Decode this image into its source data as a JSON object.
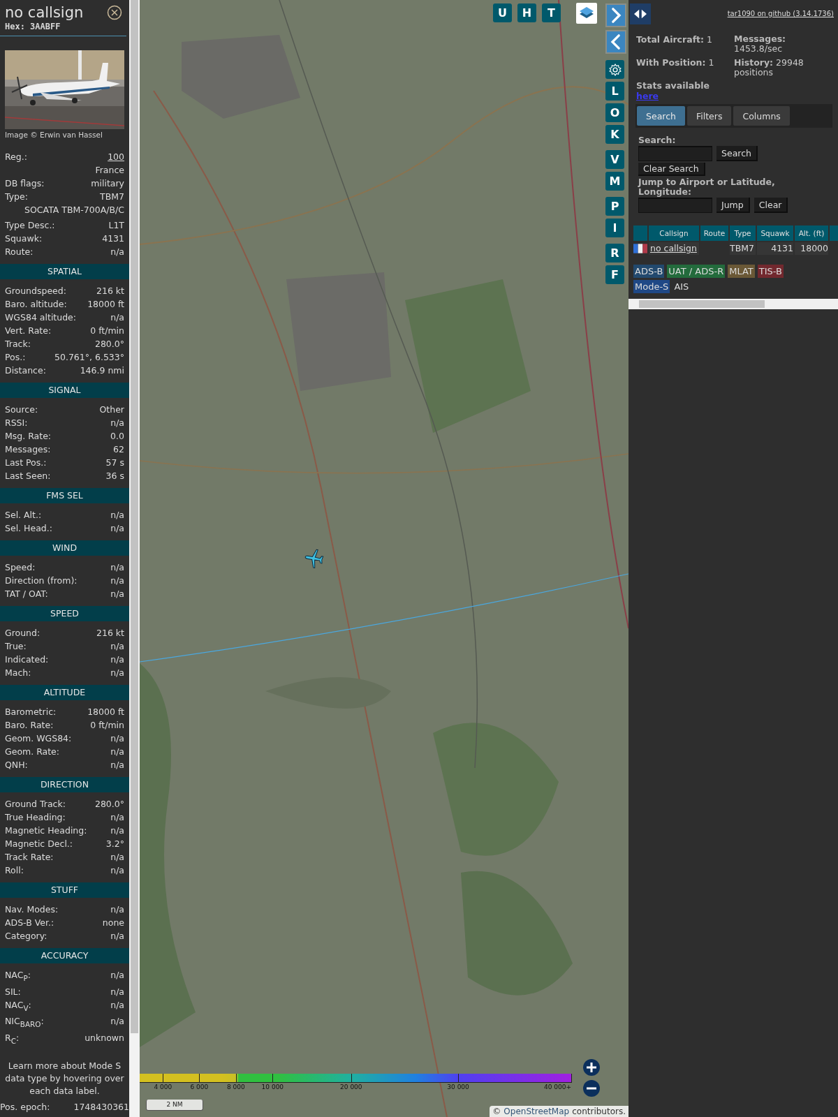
{
  "sidebar": {
    "title": "no callsign",
    "hex": "Hex: 3AABFF",
    "photo_credit": "Image © Erwin van Hassel",
    "info_rows": [
      {
        "kind": "link",
        "label": "Reg.:",
        "value": "100"
      },
      {
        "kind": "value",
        "value": "France"
      },
      {
        "kind": "pair",
        "label": "DB flags:",
        "value": "military"
      },
      {
        "kind": "pair",
        "label": "Type:",
        "value": "TBM7"
      },
      {
        "kind": "value",
        "value": "SOCATA TBM-700A/B/C"
      },
      {
        "kind": "pair",
        "label": "Type Desc.:",
        "value": "L1T"
      },
      {
        "kind": "pair",
        "label": "Squawk:",
        "value": "4131"
      },
      {
        "kind": "pair",
        "label": "Route:",
        "value": "n/a"
      }
    ],
    "sections": [
      {
        "title": "SPATIAL",
        "rows": [
          {
            "label": "Groundspeed:",
            "value": "216 kt"
          },
          {
            "label": "Baro. altitude:",
            "value": "18000 ft"
          },
          {
            "label": "WGS84 altitude:",
            "value": "n/a"
          },
          {
            "label": "Vert. Rate:",
            "value": "0 ft/min"
          },
          {
            "label": "Track:",
            "value": "280.0°"
          },
          {
            "label": "Pos.:",
            "value": "50.761°, 6.533°"
          },
          {
            "label": "Distance:",
            "value": "146.9 nmi"
          }
        ]
      },
      {
        "title": "SIGNAL",
        "rows": [
          {
            "label": "Source:",
            "value": "Other"
          },
          {
            "label": "RSSI:",
            "value": "n/a"
          },
          {
            "label": "Msg. Rate:",
            "value": "0.0"
          },
          {
            "label": "Messages:",
            "value": "62"
          },
          {
            "label": "Last Pos.:",
            "value": "57 s"
          },
          {
            "label": "Last Seen:",
            "value": "36 s"
          }
        ]
      },
      {
        "title": "FMS SEL",
        "rows": [
          {
            "label": "Sel. Alt.:",
            "value": "n/a"
          },
          {
            "label": "Sel. Head.:",
            "value": "n/a"
          }
        ]
      },
      {
        "title": "WIND",
        "rows": [
          {
            "label": "Speed:",
            "value": "n/a"
          },
          {
            "label": "Direction (from):",
            "value": "n/a"
          },
          {
            "label": "TAT / OAT:",
            "value": "n/a"
          }
        ]
      },
      {
        "title": "SPEED",
        "rows": [
          {
            "label": "Ground:",
            "value": "216 kt"
          },
          {
            "label": "True:",
            "value": "n/a"
          },
          {
            "label": "Indicated:",
            "value": "n/a"
          },
          {
            "label": "Mach:",
            "value": "n/a"
          }
        ]
      },
      {
        "title": "ALTITUDE",
        "rows": [
          {
            "label": "Barometric:",
            "value": "18000 ft"
          },
          {
            "label": "Baro. Rate:",
            "value": "0 ft/min"
          },
          {
            "label": "Geom. WGS84:",
            "value": "n/a"
          },
          {
            "label": "Geom. Rate:",
            "value": "n/a"
          },
          {
            "label": "QNH:",
            "value": "n/a"
          }
        ]
      },
      {
        "title": "DIRECTION",
        "rows": [
          {
            "label": "Ground Track:",
            "value": "280.0°"
          },
          {
            "label": "True Heading:",
            "value": "n/a"
          },
          {
            "label": "Magnetic Heading:",
            "value": "n/a"
          },
          {
            "label": "Magnetic Decl.:",
            "value": "3.2°"
          },
          {
            "label": "Track Rate:",
            "value": "n/a"
          },
          {
            "label": "Roll:",
            "value": "n/a"
          }
        ]
      },
      {
        "title": "STUFF",
        "rows": [
          {
            "label": "Nav. Modes:",
            "value": "n/a"
          },
          {
            "label": "ADS-B Ver.:",
            "value": "none"
          },
          {
            "label": "Category:",
            "value": "n/a"
          }
        ]
      },
      {
        "title": "ACCURACY",
        "rows": [
          {
            "label": "NAC$_{P}$:",
            "value": "n/a"
          },
          {
            "label": "SIL:",
            "value": "n/a"
          },
          {
            "label": "NAC$_{V}$:",
            "value": "n/a"
          },
          {
            "label": "NIC$_{BARO}$:",
            "value": "n/a"
          },
          {
            "label": "R$_{C}$:",
            "value": "unknown"
          }
        ]
      }
    ],
    "note": "Learn more about Mode S data type by hovering over each data label.",
    "footer": {
      "label": "Pos. epoch:",
      "value": "1748430361"
    }
  },
  "map": {
    "top_buttons": [
      "U",
      "H",
      "T"
    ],
    "side_groups": [
      [
        {
          "kind": "next"
        },
        {
          "kind": "prev"
        }
      ],
      [
        {
          "kind": "settings"
        },
        {
          "kind": "letter",
          "label": "L"
        },
        {
          "kind": "letter",
          "label": "O"
        },
        {
          "kind": "letter",
          "label": "K"
        }
      ],
      [
        {
          "kind": "letter",
          "label": "V"
        },
        {
          "kind": "letter",
          "label": "M"
        }
      ],
      [
        {
          "kind": "letter",
          "label": "P"
        },
        {
          "kind": "letter",
          "label": "I"
        }
      ],
      [
        {
          "kind": "letter",
          "label": "R"
        },
        {
          "kind": "letter",
          "label": "F"
        }
      ]
    ],
    "altitude_legend": [
      "4 000",
      "6 000",
      "8 000",
      "10 000",
      "20 000",
      "30 000",
      "40 000+"
    ],
    "scale": "2 NM",
    "attribution": {
      "prefix": "©",
      "link": "OpenStreetMap",
      "suffix": "contributors."
    }
  },
  "panel": {
    "github_link": "tar1090 on github (3.14.1736)",
    "stats_left": [
      {
        "label": "Total Aircraft:",
        "value": "1"
      },
      {
        "label": "With Position:",
        "value": "1"
      }
    ],
    "stats_right": [
      {
        "label": "Messages:",
        "value": "1453.8/sec"
      },
      {
        "label": "History:",
        "value": "29948 positions"
      }
    ],
    "stats_link": {
      "label": "Stats available",
      "link": "here"
    },
    "tabs": [
      {
        "label": "Search",
        "selected": true
      },
      {
        "label": "Filters",
        "selected": false
      },
      {
        "label": "Columns",
        "selected": false
      }
    ],
    "search": {
      "label": "Search:",
      "button": "Search",
      "clear_button": "Clear Search",
      "jump_label": "Jump to Airport or Latitude, Longitude:",
      "jump_button": "Jump",
      "clear_jump_button": "Clear"
    },
    "table": {
      "columns": [
        "Callsign",
        "Route",
        "Type",
        "Squawk",
        "Alt. (ft)"
      ],
      "rows": [
        {
          "callsign": "no callsign",
          "type": "TBM7",
          "squawk": "4131",
          "altitude": "18000"
        }
      ]
    },
    "sources": [
      {
        "label": "ADS-B",
        "color": "#22496e"
      },
      {
        "label": "UAT / ADS-R",
        "color": "#236b3c"
      },
      {
        "label": "MLAT",
        "color": "#6a5836"
      },
      {
        "label": "TIS-B",
        "color": "#72282e"
      },
      {
        "label": "Mode-S",
        "color": "#1f4886"
      },
      {
        "label": "AIS"
      }
    ]
  }
}
